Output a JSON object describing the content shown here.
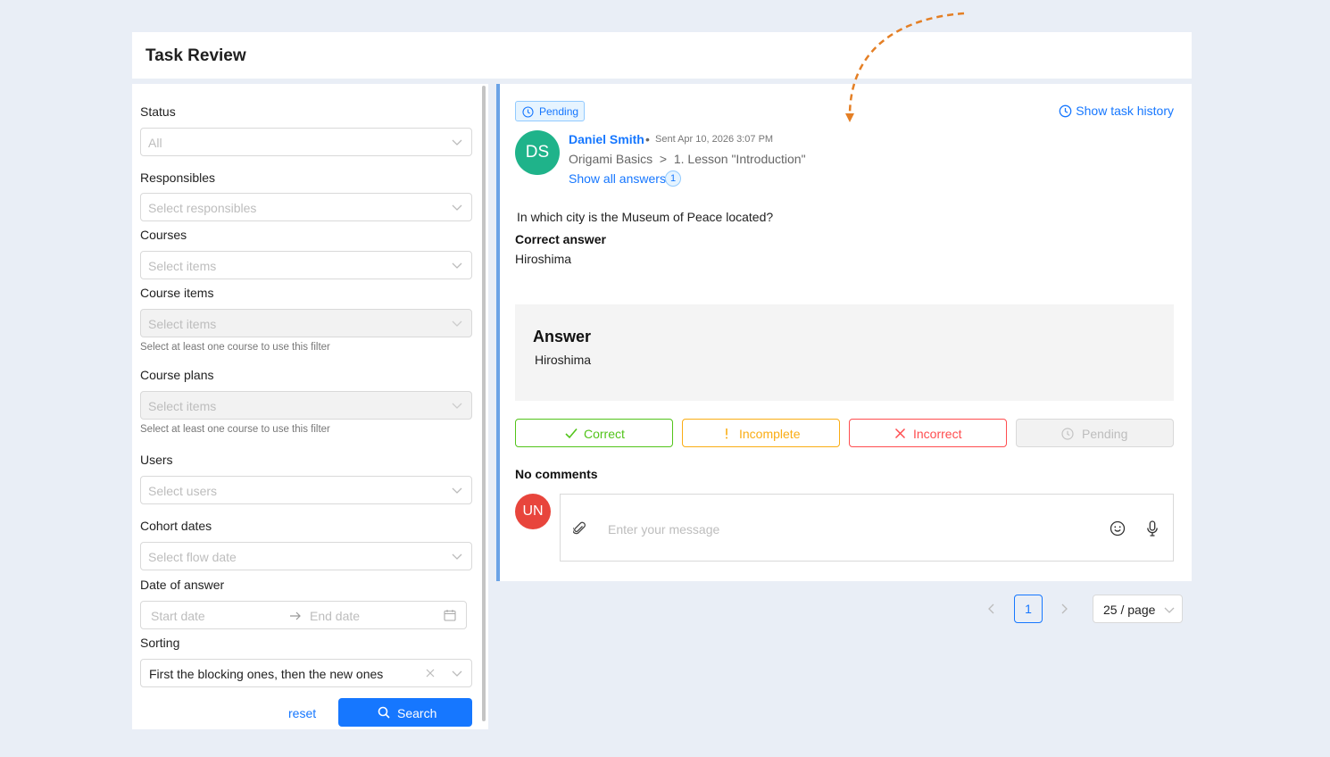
{
  "header": {
    "title": "Task Review"
  },
  "filters": {
    "status": {
      "label": "Status",
      "value": "All"
    },
    "responsibles": {
      "label": "Responsibles",
      "placeholder": "Select responsibles"
    },
    "courses": {
      "label": "Courses",
      "placeholder": "Select items"
    },
    "course_items": {
      "label": "Course items",
      "placeholder": "Select items",
      "hint": "Select at least one course to use this filter"
    },
    "course_plans": {
      "label": "Course plans",
      "placeholder": "Select items",
      "hint": "Select at least one course to use this filter"
    },
    "users": {
      "label": "Users",
      "placeholder": "Select users"
    },
    "cohort_dates": {
      "label": "Cohort dates",
      "placeholder": "Select flow date"
    },
    "date_of_answer": {
      "label": "Date of answer",
      "start_placeholder": "Start date",
      "end_placeholder": "End date"
    },
    "sorting": {
      "label": "Sorting",
      "value": "First the blocking ones, then the new ones"
    },
    "reset_label": "reset",
    "search_label": "Search"
  },
  "task": {
    "status_tag": "Pending",
    "history_link": "Show task history",
    "author_initials": "DS",
    "author_name": "Daniel Smith",
    "separator": "•",
    "sent": "Sent Apr 10, 2026 3:07 PM",
    "breadcrumb": "Origami Basics  >  1. Lesson \"Introduction\"",
    "show_all_answers": "Show all answers",
    "answers_count": "1",
    "question": "In which city is the Museum of Peace located?",
    "correct_answer_label": "Correct answer",
    "correct_answer": "Hiroshima",
    "answer_heading": "Answer",
    "answer_value": "Hiroshima",
    "grade_buttons": {
      "correct": "Correct",
      "incomplete": "Incomplete",
      "incorrect": "Incorrect",
      "pending": "Pending"
    },
    "comments_heading": "No comments",
    "commenter_initials": "UN",
    "message_placeholder": "Enter your message"
  },
  "pagination": {
    "current_page": "1",
    "page_size": "25 / page"
  },
  "colors": {
    "accent": "#1677ff",
    "correct": "#52c41a",
    "incomplete": "#faad14",
    "incorrect": "#ff4d4f",
    "avatar_author": "#1fb38a",
    "avatar_user": "#e8453c"
  }
}
